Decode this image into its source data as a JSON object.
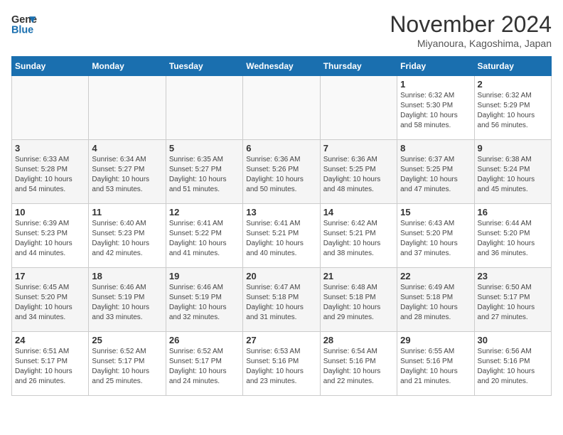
{
  "header": {
    "logo_line1": "General",
    "logo_line2": "Blue",
    "month": "November 2024",
    "location": "Miyanoura, Kagoshima, Japan"
  },
  "weekdays": [
    "Sunday",
    "Monday",
    "Tuesday",
    "Wednesday",
    "Thursday",
    "Friday",
    "Saturday"
  ],
  "weeks": [
    [
      {
        "day": "",
        "sunrise": "",
        "sunset": "",
        "daylight": ""
      },
      {
        "day": "",
        "sunrise": "",
        "sunset": "",
        "daylight": ""
      },
      {
        "day": "",
        "sunrise": "",
        "sunset": "",
        "daylight": ""
      },
      {
        "day": "",
        "sunrise": "",
        "sunset": "",
        "daylight": ""
      },
      {
        "day": "",
        "sunrise": "",
        "sunset": "",
        "daylight": ""
      },
      {
        "day": "1",
        "sunrise": "Sunrise: 6:32 AM",
        "sunset": "Sunset: 5:30 PM",
        "daylight": "Daylight: 10 hours and 58 minutes."
      },
      {
        "day": "2",
        "sunrise": "Sunrise: 6:32 AM",
        "sunset": "Sunset: 5:29 PM",
        "daylight": "Daylight: 10 hours and 56 minutes."
      }
    ],
    [
      {
        "day": "3",
        "sunrise": "Sunrise: 6:33 AM",
        "sunset": "Sunset: 5:28 PM",
        "daylight": "Daylight: 10 hours and 54 minutes."
      },
      {
        "day": "4",
        "sunrise": "Sunrise: 6:34 AM",
        "sunset": "Sunset: 5:27 PM",
        "daylight": "Daylight: 10 hours and 53 minutes."
      },
      {
        "day": "5",
        "sunrise": "Sunrise: 6:35 AM",
        "sunset": "Sunset: 5:27 PM",
        "daylight": "Daylight: 10 hours and 51 minutes."
      },
      {
        "day": "6",
        "sunrise": "Sunrise: 6:36 AM",
        "sunset": "Sunset: 5:26 PM",
        "daylight": "Daylight: 10 hours and 50 minutes."
      },
      {
        "day": "7",
        "sunrise": "Sunrise: 6:36 AM",
        "sunset": "Sunset: 5:25 PM",
        "daylight": "Daylight: 10 hours and 48 minutes."
      },
      {
        "day": "8",
        "sunrise": "Sunrise: 6:37 AM",
        "sunset": "Sunset: 5:25 PM",
        "daylight": "Daylight: 10 hours and 47 minutes."
      },
      {
        "day": "9",
        "sunrise": "Sunrise: 6:38 AM",
        "sunset": "Sunset: 5:24 PM",
        "daylight": "Daylight: 10 hours and 45 minutes."
      }
    ],
    [
      {
        "day": "10",
        "sunrise": "Sunrise: 6:39 AM",
        "sunset": "Sunset: 5:23 PM",
        "daylight": "Daylight: 10 hours and 44 minutes."
      },
      {
        "day": "11",
        "sunrise": "Sunrise: 6:40 AM",
        "sunset": "Sunset: 5:23 PM",
        "daylight": "Daylight: 10 hours and 42 minutes."
      },
      {
        "day": "12",
        "sunrise": "Sunrise: 6:41 AM",
        "sunset": "Sunset: 5:22 PM",
        "daylight": "Daylight: 10 hours and 41 minutes."
      },
      {
        "day": "13",
        "sunrise": "Sunrise: 6:41 AM",
        "sunset": "Sunset: 5:21 PM",
        "daylight": "Daylight: 10 hours and 40 minutes."
      },
      {
        "day": "14",
        "sunrise": "Sunrise: 6:42 AM",
        "sunset": "Sunset: 5:21 PM",
        "daylight": "Daylight: 10 hours and 38 minutes."
      },
      {
        "day": "15",
        "sunrise": "Sunrise: 6:43 AM",
        "sunset": "Sunset: 5:20 PM",
        "daylight": "Daylight: 10 hours and 37 minutes."
      },
      {
        "day": "16",
        "sunrise": "Sunrise: 6:44 AM",
        "sunset": "Sunset: 5:20 PM",
        "daylight": "Daylight: 10 hours and 36 minutes."
      }
    ],
    [
      {
        "day": "17",
        "sunrise": "Sunrise: 6:45 AM",
        "sunset": "Sunset: 5:20 PM",
        "daylight": "Daylight: 10 hours and 34 minutes."
      },
      {
        "day": "18",
        "sunrise": "Sunrise: 6:46 AM",
        "sunset": "Sunset: 5:19 PM",
        "daylight": "Daylight: 10 hours and 33 minutes."
      },
      {
        "day": "19",
        "sunrise": "Sunrise: 6:46 AM",
        "sunset": "Sunset: 5:19 PM",
        "daylight": "Daylight: 10 hours and 32 minutes."
      },
      {
        "day": "20",
        "sunrise": "Sunrise: 6:47 AM",
        "sunset": "Sunset: 5:18 PM",
        "daylight": "Daylight: 10 hours and 31 minutes."
      },
      {
        "day": "21",
        "sunrise": "Sunrise: 6:48 AM",
        "sunset": "Sunset: 5:18 PM",
        "daylight": "Daylight: 10 hours and 29 minutes."
      },
      {
        "day": "22",
        "sunrise": "Sunrise: 6:49 AM",
        "sunset": "Sunset: 5:18 PM",
        "daylight": "Daylight: 10 hours and 28 minutes."
      },
      {
        "day": "23",
        "sunrise": "Sunrise: 6:50 AM",
        "sunset": "Sunset: 5:17 PM",
        "daylight": "Daylight: 10 hours and 27 minutes."
      }
    ],
    [
      {
        "day": "24",
        "sunrise": "Sunrise: 6:51 AM",
        "sunset": "Sunset: 5:17 PM",
        "daylight": "Daylight: 10 hours and 26 minutes."
      },
      {
        "day": "25",
        "sunrise": "Sunrise: 6:52 AM",
        "sunset": "Sunset: 5:17 PM",
        "daylight": "Daylight: 10 hours and 25 minutes."
      },
      {
        "day": "26",
        "sunrise": "Sunrise: 6:52 AM",
        "sunset": "Sunset: 5:17 PM",
        "daylight": "Daylight: 10 hours and 24 minutes."
      },
      {
        "day": "27",
        "sunrise": "Sunrise: 6:53 AM",
        "sunset": "Sunset: 5:16 PM",
        "daylight": "Daylight: 10 hours and 23 minutes."
      },
      {
        "day": "28",
        "sunrise": "Sunrise: 6:54 AM",
        "sunset": "Sunset: 5:16 PM",
        "daylight": "Daylight: 10 hours and 22 minutes."
      },
      {
        "day": "29",
        "sunrise": "Sunrise: 6:55 AM",
        "sunset": "Sunset: 5:16 PM",
        "daylight": "Daylight: 10 hours and 21 minutes."
      },
      {
        "day": "30",
        "sunrise": "Sunrise: 6:56 AM",
        "sunset": "Sunset: 5:16 PM",
        "daylight": "Daylight: 10 hours and 20 minutes."
      }
    ]
  ]
}
